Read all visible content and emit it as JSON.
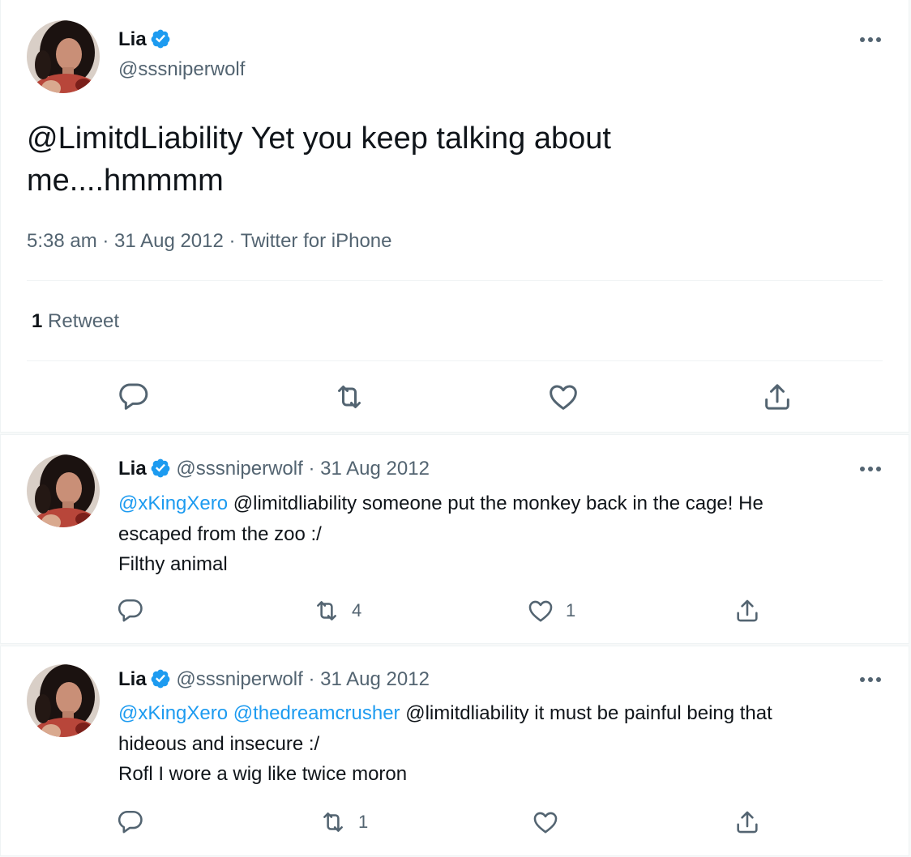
{
  "main_tweet": {
    "author_name": "Lia",
    "author_handle": "@sssniperwolf",
    "text_mention": "@LimitdLiability",
    "text_line1_rest": " Yet you keep talking about",
    "text_line2": "me....hmmmm",
    "timestamp": "5:38 am · 31 Aug 2012 · Twitter for iPhone",
    "retweet_count": "1",
    "retweet_label": "Retweet"
  },
  "replies": [
    {
      "author_name": "Lia",
      "author_handle": "@sssniperwolf",
      "date_sep": " · ",
      "date": "31 Aug 2012",
      "mention1": "@xKingXero",
      "line1_rest": " @limitdliability someone put the monkey back in the cage! He",
      "line2": "escaped from the zoo :/",
      "line3": "Filthy animal",
      "retweets": "4",
      "likes": "1"
    },
    {
      "author_name": "Lia",
      "author_handle": "@sssniperwolf",
      "date_sep": " · ",
      "date": "31 Aug 2012",
      "mention1": "@xKingXero",
      "mention2": "@thedreamcrusher",
      "line1_rest": " @limitdliability it must be painful being that",
      "line2": "hideous and insecure :/",
      "line3": "Rofl I wore a wig like twice moron",
      "retweets": "1"
    }
  ],
  "colors": {
    "accent": "#1d9bf0",
    "text": "#0f1419",
    "muted": "#536471",
    "border": "#eff3f4"
  },
  "icons": [
    "verified-badge-icon",
    "more-options-icon",
    "reply-icon",
    "retweet-icon",
    "like-icon",
    "share-icon"
  ]
}
